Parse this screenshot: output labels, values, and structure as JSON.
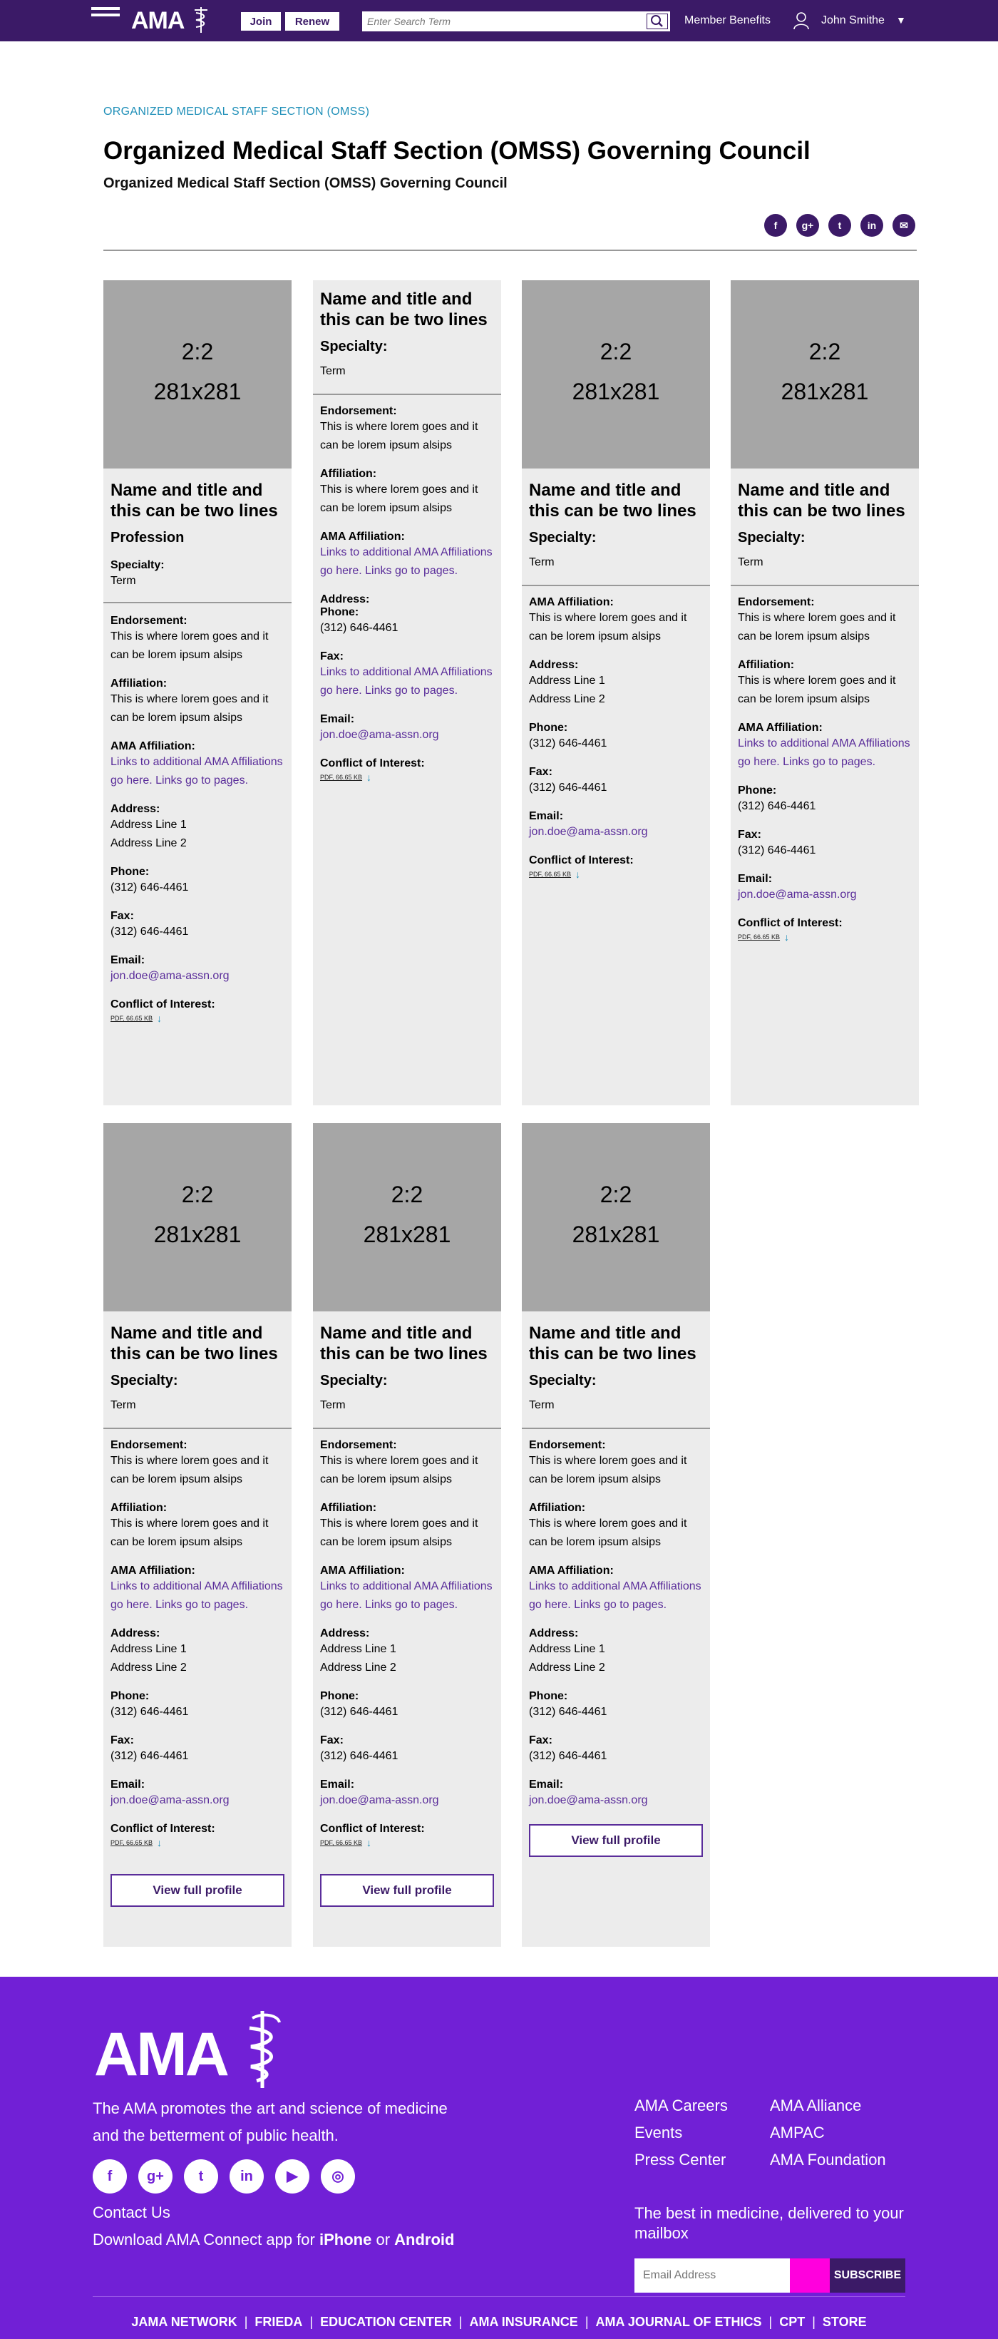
{
  "header": {
    "menu_label": "MENU",
    "logo_text": "AMA",
    "join_label": "Join",
    "renew_label": "Renew",
    "search_placeholder": "Enter Search Term",
    "member_benefits": "Member Benefits",
    "user_name": "John Smithe",
    "caret": "▼"
  },
  "page": {
    "eyebrow": "ORGANIZED MEDICAL STAFF SECTION (OMSS)",
    "title": "Organized Medical Staff Section (OMSS) Governing Council",
    "subtitle": "Organized Medical Staff Section (OMSS) Governing Council"
  },
  "share": [
    {
      "icon": "facebook-icon",
      "glyph": "f"
    },
    {
      "icon": "google-plus-icon",
      "glyph": "g+"
    },
    {
      "icon": "twitter-icon",
      "glyph": "t"
    },
    {
      "icon": "linkedin-icon",
      "glyph": "in"
    },
    {
      "icon": "email-icon",
      "glyph": "✉"
    }
  ],
  "common": {
    "ratio": "2:2",
    "size": "281x281",
    "name": "Name and title and this can be two lines",
    "profession": "Profession",
    "specialty_label": "Specialty:",
    "term": "Term",
    "endorsement_label": "Endorsement:",
    "endorsement_text": "This is where lorem goes and it can be lorem ipsum alsips",
    "affiliation_label": "Affiliation:",
    "affiliation_text": "This is where lorem goes and it can be lorem ipsum alsips",
    "ama_affiliation_label": "AMA Affiliation:",
    "ama_affiliation_link": "Links to additional AMA Affiliations go here. Links go to pages.",
    "address_label": "Address:",
    "address_line1": "Address Line 1",
    "address_line2": "Address Line 2",
    "phone_label": "Phone:",
    "phone": "(312) 646-4461",
    "fax_label": "Fax:",
    "fax": "(312) 646-4461",
    "fax_link": "Links to additional AMA Affiliations go here. Links go to pages.",
    "email_label": "Email:",
    "email": "jon.doe@ama-assn.org",
    "conflict_label": "Conflict of Interest:",
    "pdf": "PDF, 66.65 KB",
    "view_profile": "View full profile"
  },
  "footer": {
    "logo_text": "AMA",
    "tagline": "The AMA promotes the art and science of medicine and the betterment of public health.",
    "social": [
      {
        "icon": "facebook-icon",
        "glyph": "f"
      },
      {
        "icon": "google-plus-icon",
        "glyph": "g+"
      },
      {
        "icon": "twitter-icon",
        "glyph": "t"
      },
      {
        "icon": "linkedin-icon",
        "glyph": "in"
      },
      {
        "icon": "youtube-icon",
        "glyph": "▶"
      },
      {
        "icon": "instagram-icon",
        "glyph": "◎"
      }
    ],
    "contact": "Contact Us",
    "app_prefix": "Download AMA Connect app for",
    "app_iphone": "iPhone",
    "app_or": "or",
    "app_android": "Android",
    "col1": [
      "AMA Careers",
      "Events",
      "Press Center"
    ],
    "col2": [
      "AMA Alliance",
      "AMPAC",
      "AMA Foundation"
    ],
    "newsletter": "The best in medicine, delivered to your mailbox",
    "email_placeholder": "Email Address",
    "subscribe": "SUBSCRIBE",
    "bottom_links": [
      "JAMA NETWORK",
      "FRIEDA",
      "EDUCATION CENTER",
      "AMA INSURANCE",
      "AMA JOURNAL OF ETHICS",
      "CPT",
      "STORE"
    ]
  },
  "colors": {
    "header_bg": "#3b1a67",
    "footer_bg": "#7120d6",
    "accent_pink": "#ff00dd",
    "link": "#5a2d9a",
    "eyebrow": "#1f8fb8"
  }
}
